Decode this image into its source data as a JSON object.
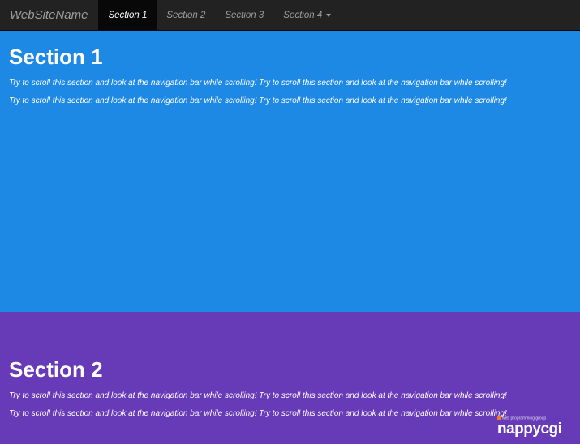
{
  "navbar": {
    "brand": "WebSiteName",
    "items": [
      {
        "label": "Section 1",
        "active": true
      },
      {
        "label": "Section 2",
        "active": false
      },
      {
        "label": "Section 3",
        "active": false
      },
      {
        "label": "Section 4",
        "active": false,
        "dropdown": true
      }
    ]
  },
  "sections": [
    {
      "title": "Section 1",
      "color": "#1e88e5",
      "paragraphs": [
        "Try to scroll this section and look at the navigation bar while scrolling! Try to scroll this section and look at the navigation bar while scrolling!",
        "Try to scroll this section and look at the navigation bar while scrolling! Try to scroll this section and look at the navigation bar while scrolling!"
      ]
    },
    {
      "title": "Section 2",
      "color": "#673ab7",
      "paragraphs": [
        "Try to scroll this section and look at the navigation bar while scrolling! Try to scroll this section and look at the navigation bar while scrolling!",
        "Try to scroll this section and look at the navigation bar while scrolling! Try to scroll this section and look at the navigation bar while scrolling!"
      ]
    }
  ],
  "watermark": {
    "tagline": "web programming group",
    "logo_text": "nappycgi"
  },
  "colors": {
    "navbar_bg": "#222222",
    "navbar_active_bg": "#080808",
    "navbar_text": "#9d9d9d"
  }
}
